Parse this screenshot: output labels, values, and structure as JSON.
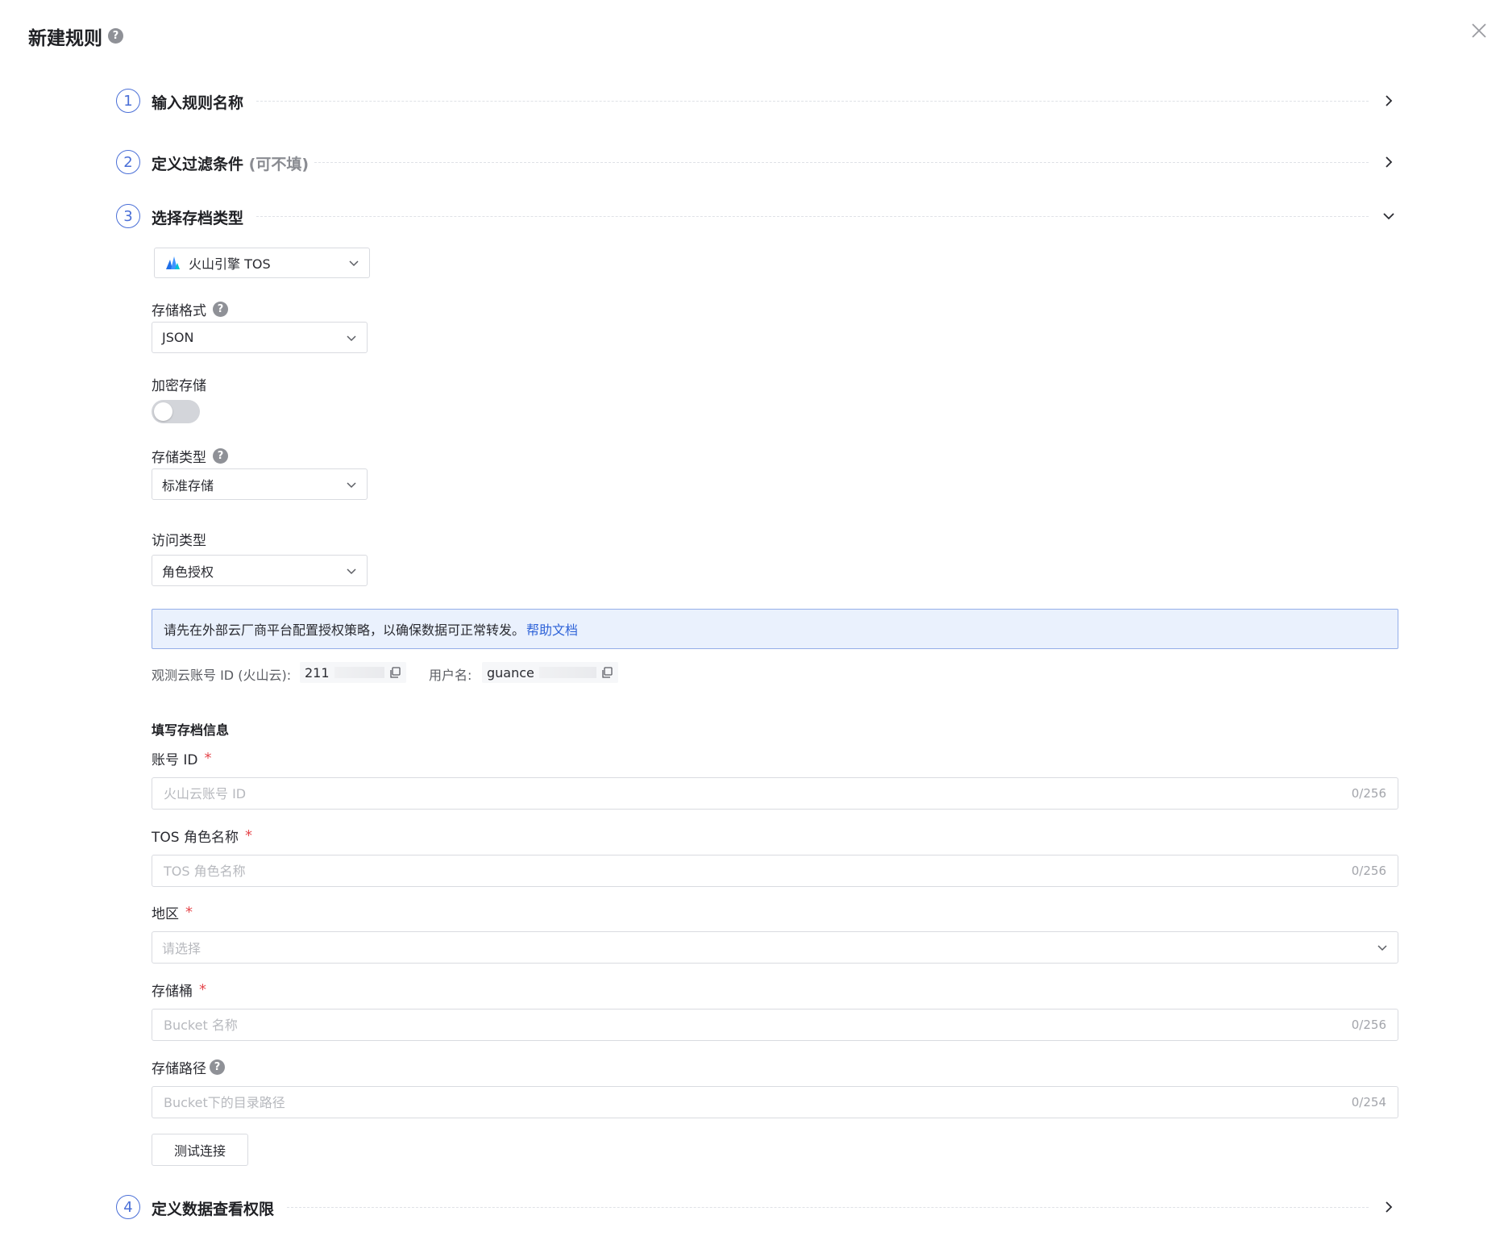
{
  "header": {
    "title": "新建规则",
    "help_icon": "?"
  },
  "steps": [
    {
      "num": "1",
      "title": "输入规则名称",
      "optional": ""
    },
    {
      "num": "2",
      "title": "定义过滤条件",
      "optional": "(可不填)"
    },
    {
      "num": "3",
      "title": "选择存档类型",
      "optional": ""
    },
    {
      "num": "4",
      "title": "定义数据查看权限",
      "optional": ""
    }
  ],
  "archive_type": {
    "selected": "火山引擎 TOS",
    "icon": "volcengine-logo-icon"
  },
  "fields": {
    "storage_format": {
      "label": "存储格式",
      "value": "JSON"
    },
    "encrypt": {
      "label": "加密存储",
      "enabled": false
    },
    "storage_type": {
      "label": "存储类型",
      "value": "标准存储"
    },
    "access_type": {
      "label": "访问类型",
      "value": "角色授权"
    }
  },
  "notice": {
    "text": "请先在外部云厂商平台配置授权策略，以确保数据可正常转发。",
    "link": "帮助文档"
  },
  "account_meta": {
    "account_label": "观测云账号 ID (火山云):",
    "account_value": "211",
    "user_label": "用户名:",
    "user_value": "guance"
  },
  "archive_info": {
    "section_title": "填写存档信息",
    "account_id": {
      "label": "账号 ID",
      "placeholder": "火山云账号 ID",
      "count": "0/256"
    },
    "tos_role": {
      "label": "TOS 角色名称",
      "placeholder": "TOS 角色名称",
      "count": "0/256"
    },
    "region": {
      "label": "地区",
      "placeholder": "请选择"
    },
    "bucket": {
      "label": "存储桶",
      "placeholder": "Bucket 名称",
      "count": "0/256"
    },
    "path": {
      "label": "存储路径",
      "placeholder": "Bucket下的目录路径",
      "count": "0/254"
    },
    "required_mark": "*"
  },
  "buttons": {
    "test_connection": "测试连接"
  },
  "colors": {
    "accent": "#4a6fd7",
    "link": "#2f63d8",
    "required": "#e5484d",
    "notice_bg": "#eaf1fd"
  }
}
